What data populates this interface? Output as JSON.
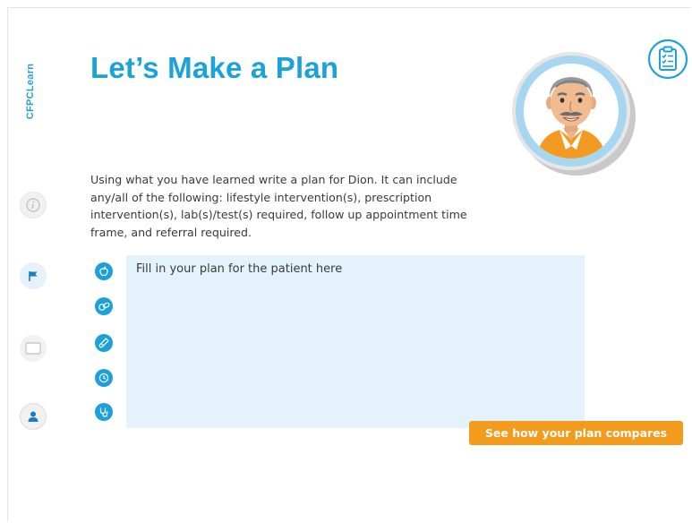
{
  "brand": {
    "name": "CFPCLearn"
  },
  "page": {
    "title": "Let’s Make a Plan",
    "instructions": "Using what you have learned write a plan for Dion. It can include any/all of the following: lifestyle intervention(s), prescription intervention(s), lab(s)/test(s) required, follow up appointment time frame, and referral required."
  },
  "plan": {
    "placeholder": "Fill in your plan for the patient here",
    "value": ""
  },
  "actions": {
    "compare_label": "See how your plan compares"
  },
  "sidebar": [
    {
      "icon": "info-icon"
    },
    {
      "icon": "flag-icon"
    },
    {
      "icon": "slide-icon"
    },
    {
      "icon": "user-icon"
    }
  ],
  "categories": [
    {
      "icon": "apple-icon"
    },
    {
      "icon": "pills-icon"
    },
    {
      "icon": "test-tube-icon"
    },
    {
      "icon": "clock-icon"
    },
    {
      "icon": "stethoscope-icon"
    }
  ],
  "colors": {
    "accent": "#1ba2d8",
    "button": "#f39b1d",
    "panel": "#e4f3fb"
  }
}
